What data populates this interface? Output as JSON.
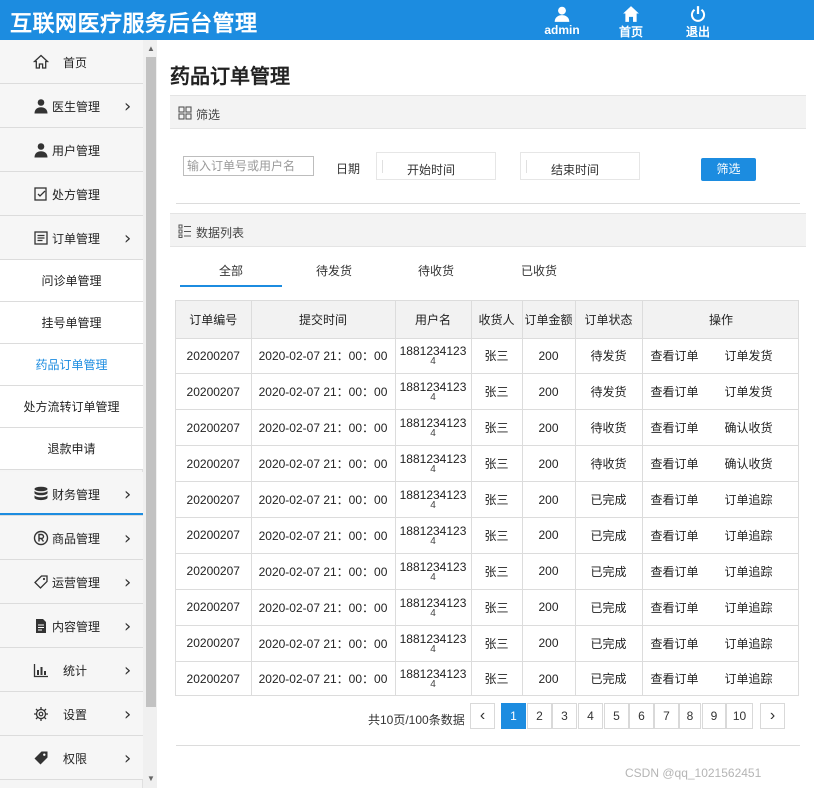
{
  "app": {
    "title": "互联网医疗服务后台管理",
    "top_actions": [
      {
        "label": "admin",
        "icon": "user-icon"
      },
      {
        "label": "首页",
        "icon": "home-icon"
      },
      {
        "label": "退出",
        "icon": "power-icon"
      }
    ]
  },
  "sidebar": {
    "items": [
      {
        "label": "首页",
        "icon": "home-icon",
        "chevron": false
      },
      {
        "label": "医生管理",
        "icon": "doctor-icon",
        "chevron": true
      },
      {
        "label": "用户管理",
        "icon": "user-icon",
        "chevron": false
      },
      {
        "label": "处方管理",
        "icon": "prescription-icon",
        "chevron": false
      },
      {
        "label": "订单管理",
        "icon": "order-icon",
        "chevron": true
      },
      {
        "label": "财务管理",
        "icon": "database-icon",
        "chevron": true
      },
      {
        "label": "商品管理",
        "icon": "registered-icon",
        "chevron": true
      },
      {
        "label": "运营管理",
        "icon": "tag-icon",
        "chevron": true
      },
      {
        "label": "内容管理",
        "icon": "document-icon",
        "chevron": true
      },
      {
        "label": "统计",
        "icon": "bar-chart-icon",
        "chevron": true
      },
      {
        "label": "设置",
        "icon": "gear-icon",
        "chevron": true
      },
      {
        "label": "权限",
        "icon": "tag-filled-icon",
        "chevron": true
      }
    ],
    "sub_items": [
      "问诊单管理",
      "挂号单管理",
      "药品订单管理",
      "处方流转订单管理",
      "退款申请"
    ],
    "active_sub": "药品订单管理"
  },
  "main": {
    "page_title": "药品订单管理",
    "filter": {
      "section_label": "筛选",
      "search_placeholder": "输入订单号或用户名",
      "date_label": "日期",
      "start_placeholder": "开始时间",
      "end_placeholder": "结束时间",
      "button_label": "筛选"
    },
    "list": {
      "section_label": "数据列表",
      "tabs": [
        "全部",
        "待发货",
        "待收货",
        "已收货"
      ],
      "active_tab": "全部",
      "columns": [
        "订单编号",
        "提交时间",
        "用户名",
        "收货人",
        "订单金额",
        "订单状态",
        "操作"
      ],
      "rows": [
        {
          "id": "20200207",
          "time": "2020-02-07 21：00：00",
          "user": "1881234123",
          "user_tail": "4",
          "receiver": "张三",
          "amount": "200",
          "status": "待发货",
          "op1": "查看订单",
          "op2": "订单发货"
        },
        {
          "id": "20200207",
          "time": "2020-02-07 21：00：00",
          "user": "1881234123",
          "user_tail": "4",
          "receiver": "张三",
          "amount": "200",
          "status": "待发货",
          "op1": "查看订单",
          "op2": "订单发货"
        },
        {
          "id": "20200207",
          "time": "2020-02-07 21：00：00",
          "user": "1881234123",
          "user_tail": "4",
          "receiver": "张三",
          "amount": "200",
          "status": "待收货",
          "op1": "查看订单",
          "op2": "确认收货"
        },
        {
          "id": "20200207",
          "time": "2020-02-07 21：00：00",
          "user": "1881234123",
          "user_tail": "4",
          "receiver": "张三",
          "amount": "200",
          "status": "待收货",
          "op1": "查看订单",
          "op2": "确认收货"
        },
        {
          "id": "20200207",
          "time": "2020-02-07 21：00：00",
          "user": "1881234123",
          "user_tail": "4",
          "receiver": "张三",
          "amount": "200",
          "status": "已完成",
          "op1": "查看订单",
          "op2": "订单追踪"
        },
        {
          "id": "20200207",
          "time": "2020-02-07 21：00：00",
          "user": "1881234123",
          "user_tail": "4",
          "receiver": "张三",
          "amount": "200",
          "status": "已完成",
          "op1": "查看订单",
          "op2": "订单追踪"
        },
        {
          "id": "20200207",
          "time": "2020-02-07 21：00：00",
          "user": "1881234123",
          "user_tail": "4",
          "receiver": "张三",
          "amount": "200",
          "status": "已完成",
          "op1": "查看订单",
          "op2": "订单追踪"
        },
        {
          "id": "20200207",
          "time": "2020-02-07 21：00：00",
          "user": "1881234123",
          "user_tail": "4",
          "receiver": "张三",
          "amount": "200",
          "status": "已完成",
          "op1": "查看订单",
          "op2": "订单追踪"
        },
        {
          "id": "20200207",
          "time": "2020-02-07 21：00：00",
          "user": "1881234123",
          "user_tail": "4",
          "receiver": "张三",
          "amount": "200",
          "status": "已完成",
          "op1": "查看订单",
          "op2": "订单追踪"
        },
        {
          "id": "20200207",
          "time": "2020-02-07 21：00：00",
          "user": "1881234123",
          "user_tail": "4",
          "receiver": "张三",
          "amount": "200",
          "status": "已完成",
          "op1": "查看订单",
          "op2": "订单追踪"
        }
      ]
    },
    "pagination": {
      "info": "共10页/100条数据",
      "pages": [
        "1",
        "2",
        "3",
        "4",
        "5",
        "6",
        "7",
        "8",
        "9",
        "10"
      ],
      "current": "1",
      "prev": "‹",
      "next": "›"
    }
  },
  "watermark": "CSDN @qq_1021562451",
  "colors": {
    "accent": "#1c8ce0",
    "sidebar_bg": "#f5f5f5",
    "header_bg": "#f3f3f3"
  }
}
